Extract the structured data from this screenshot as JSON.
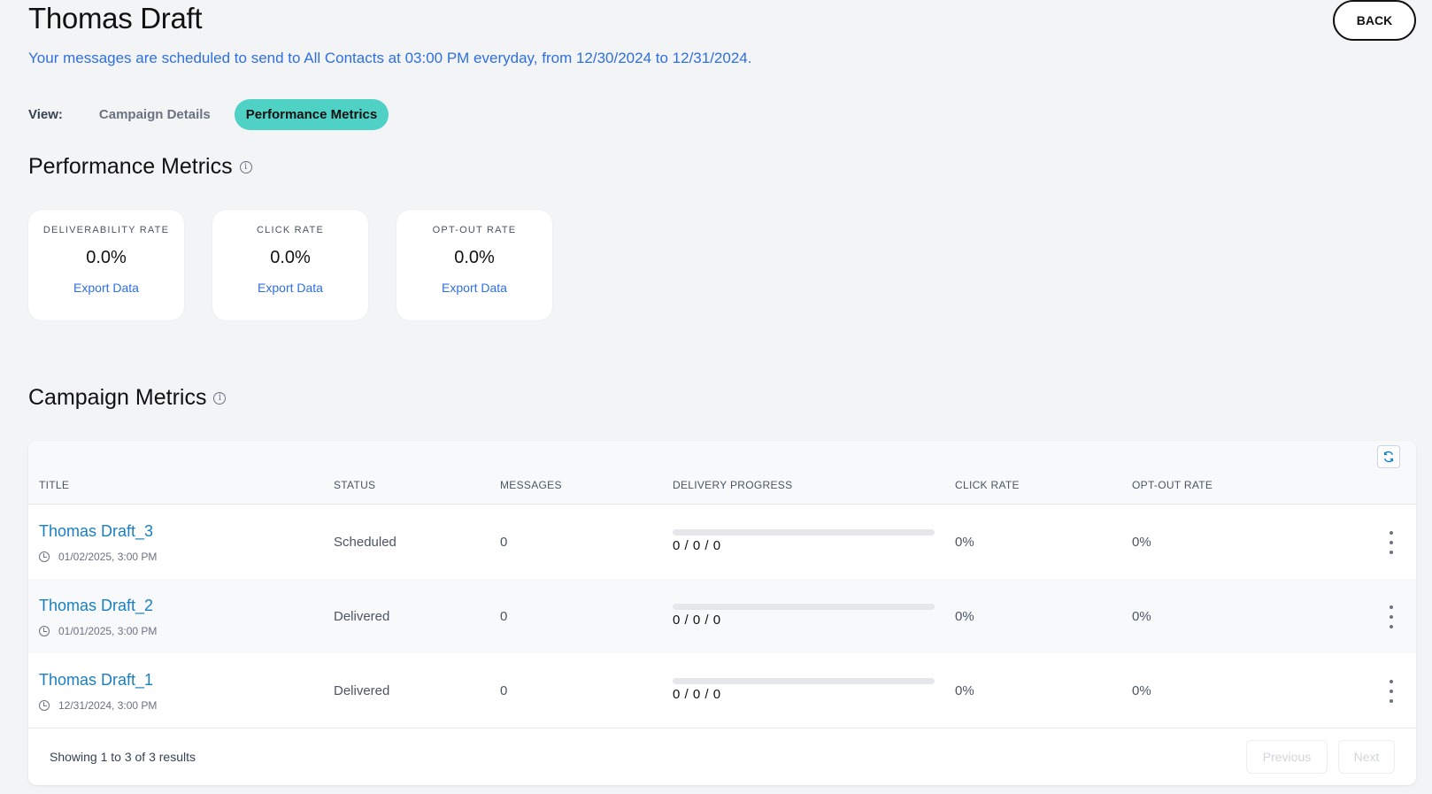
{
  "header": {
    "title": "Thomas Draft",
    "back_label": "BACK",
    "schedule": "Your messages are scheduled to send to All Contacts at 03:00 PM everyday, from 12/30/2024 to 12/31/2024."
  },
  "view": {
    "label": "View:",
    "tabs": [
      {
        "label": "Campaign Details",
        "active": false
      },
      {
        "label": "Performance Metrics",
        "active": true
      }
    ]
  },
  "performance": {
    "title": "Performance Metrics",
    "cards": [
      {
        "label": "DELIVERABILITY RATE",
        "value": "0.0%",
        "link": "Export Data"
      },
      {
        "label": "CLICK RATE",
        "value": "0.0%",
        "link": "Export Data"
      },
      {
        "label": "OPT-OUT RATE",
        "value": "0.0%",
        "link": "Export Data"
      }
    ]
  },
  "campaign": {
    "title": "Campaign Metrics",
    "columns": [
      "TITLE",
      "STATUS",
      "MESSAGES",
      "DELIVERY PROGRESS",
      "CLICK RATE",
      "OPT-OUT RATE"
    ],
    "rows": [
      {
        "title": "Thomas Draft_3",
        "date": "01/02/2025, 3:00 PM",
        "status": "Scheduled",
        "messages": "0",
        "progress_text": "0 / 0 / 0",
        "progress": 0,
        "click_rate": "0%",
        "optout_rate": "0%"
      },
      {
        "title": "Thomas Draft_2",
        "date": "01/01/2025, 3:00 PM",
        "status": "Delivered",
        "messages": "0",
        "progress_text": "0 / 0 / 0",
        "progress": 0,
        "click_rate": "0%",
        "optout_rate": "0%"
      },
      {
        "title": "Thomas Draft_1",
        "date": "12/31/2024, 3:00 PM",
        "status": "Delivered",
        "messages": "0",
        "progress_text": "0 / 0 / 0",
        "progress": 0,
        "click_rate": "0%",
        "optout_rate": "0%"
      }
    ],
    "footer": {
      "showing": "Showing 1 to 3 of 3 results",
      "previous": "Previous",
      "next": "Next"
    }
  },
  "colors": {
    "accent": "#4fd1c5",
    "link": "#2f6fe0",
    "row_title": "#1a7fbf"
  },
  "icons": {
    "info": "info-icon",
    "clock": "clock-icon",
    "refresh": "refresh-icon",
    "more": "kebab-menu-icon"
  }
}
